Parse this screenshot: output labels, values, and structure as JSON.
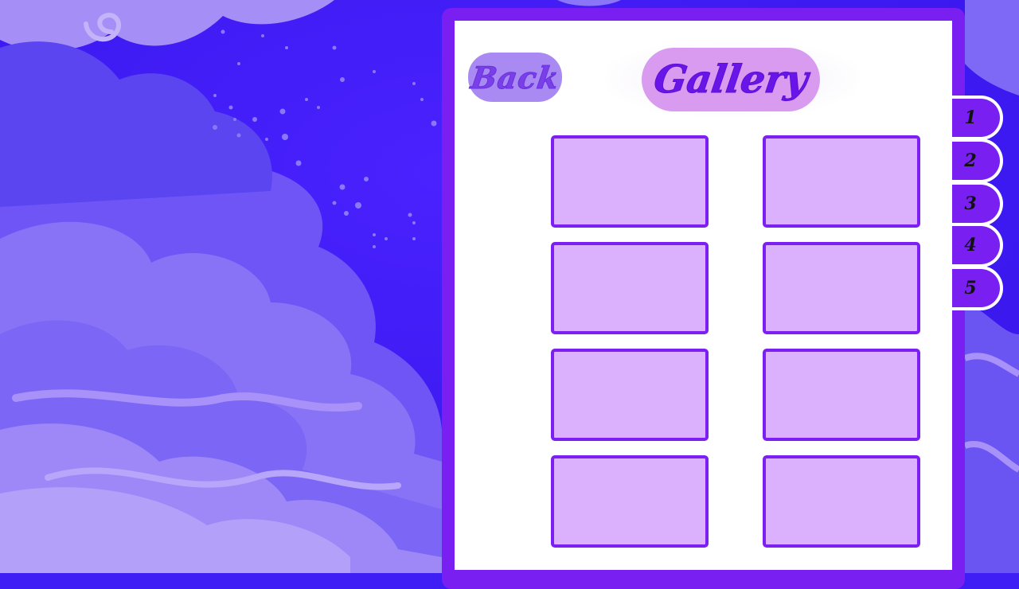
{
  "header": {
    "back_label": "Back",
    "title": "Gallery"
  },
  "gallery": {
    "slots": [
      "",
      "",
      "",
      "",
      "",
      "",
      "",
      ""
    ]
  },
  "pages": [
    "1",
    "2",
    "3",
    "4",
    "5"
  ],
  "colors": {
    "sky": "#3f1df5",
    "cloud_light": "#a58ff7",
    "cloud_mid": "#7b66f6",
    "panel_border": "#7a1ff2",
    "slot_fill": "#dbb0fc",
    "title_badge": "#d99bf0",
    "back_badge": "#a98af3"
  },
  "icons": [
    "back-label-badge",
    "swirl-cloud-icon",
    "star-dots"
  ]
}
